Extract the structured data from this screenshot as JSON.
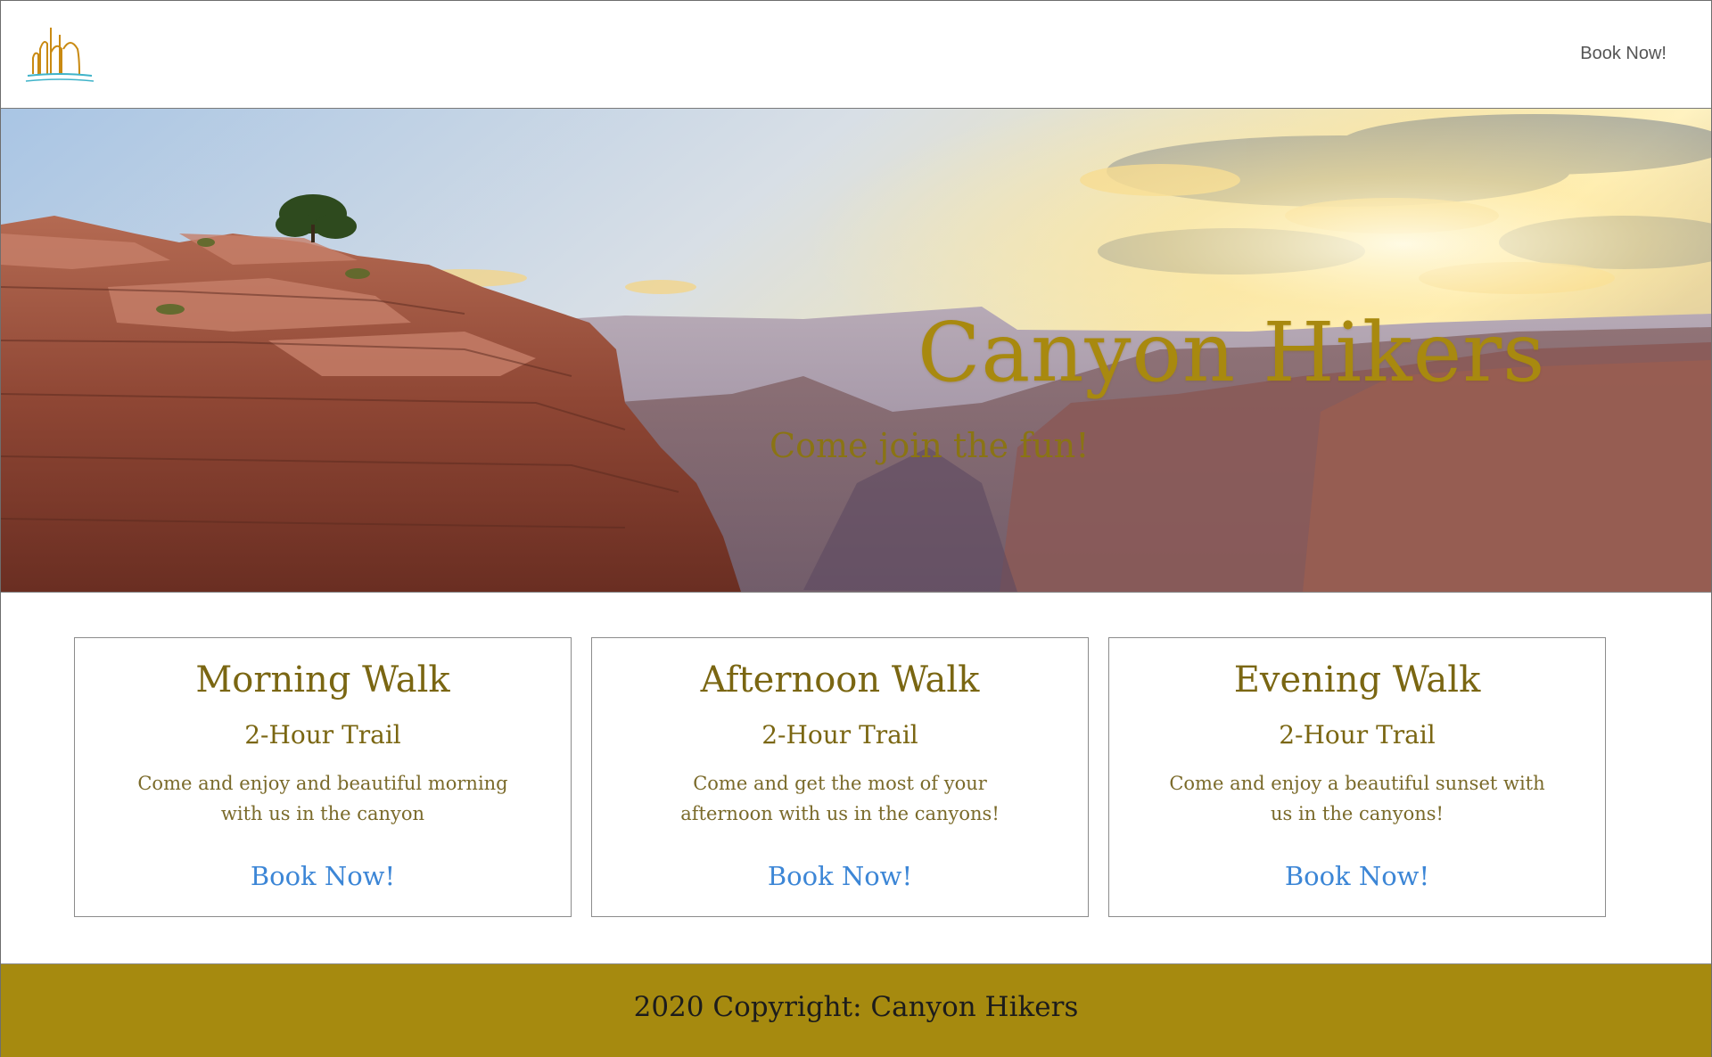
{
  "header": {
    "logo_icon": "canyon-logo-icon",
    "nav_book_label": "Book Now!"
  },
  "hero": {
    "title": "Canyon Hikers",
    "subtitle": "Come join the fun!",
    "colors": {
      "title": "#a8890f",
      "subtitle": "#8a7414"
    }
  },
  "cards": [
    {
      "title": "Morning Walk",
      "subtitle": "2-Hour Trail",
      "description": "Come and enjoy and beautiful morning with us in the canyon",
      "book_label": "Book Now!"
    },
    {
      "title": "Afternoon Walk",
      "subtitle": "2-Hour Trail",
      "description": "Come and get the most of your afternoon with us in the canyons!",
      "book_label": "Book Now!"
    },
    {
      "title": "Evening Walk",
      "subtitle": "2-Hour Trail",
      "description": "Come and enjoy a beautiful sunset with us in the canyons!",
      "book_label": "Book Now!"
    }
  ],
  "footer": {
    "text": "2020 Copyright: Canyon Hikers",
    "background": "#a68a0f"
  },
  "colors": {
    "link": "#3c86d6",
    "card_text": "#7a6612"
  }
}
